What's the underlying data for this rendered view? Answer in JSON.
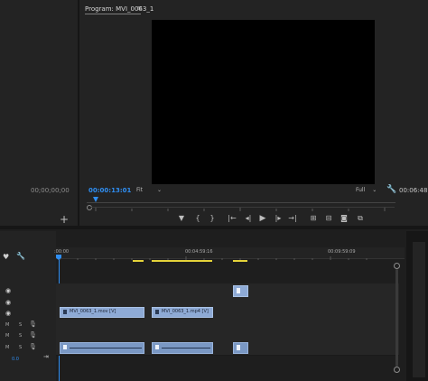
{
  "program_monitor": {
    "tab_title": "Program: MVI_0063_1",
    "menu_glyph": "≡",
    "current_timecode": "00:00:13:01",
    "fit_label": "Fit",
    "quality_label": "Full",
    "duration_timecode": "00:06:48:"
  },
  "source_panel": {
    "timecode": "00;00;00;00",
    "add_glyph": "+"
  },
  "transport": {
    "marker": "▼",
    "in": "{",
    "out": "}",
    "go_in": "|←",
    "step_back": "◂|",
    "play": "▶",
    "step_fwd": "|▸",
    "go_out": "→|",
    "insert": "⊞",
    "overwrite": "⊟",
    "export_frame": "◙",
    "button_editor": "⧉"
  },
  "timeline": {
    "ruler_labels": [
      ":00:00",
      "00:04:59:16",
      "00:09:59:09"
    ],
    "zoom_value": "0.0",
    "video_clip_1": "MVI_0063_1.mov [V]",
    "video_clip_2": "MVI_0063_1.mp4 [V]",
    "track_m": "M",
    "track_s": "S",
    "mic_glyph": "🎙",
    "eye_glyph": "◉"
  },
  "colors": {
    "accent_blue": "#2f8ef2",
    "clip_blue": "#8eaad5",
    "work_area_yellow": "#e4d23a"
  }
}
